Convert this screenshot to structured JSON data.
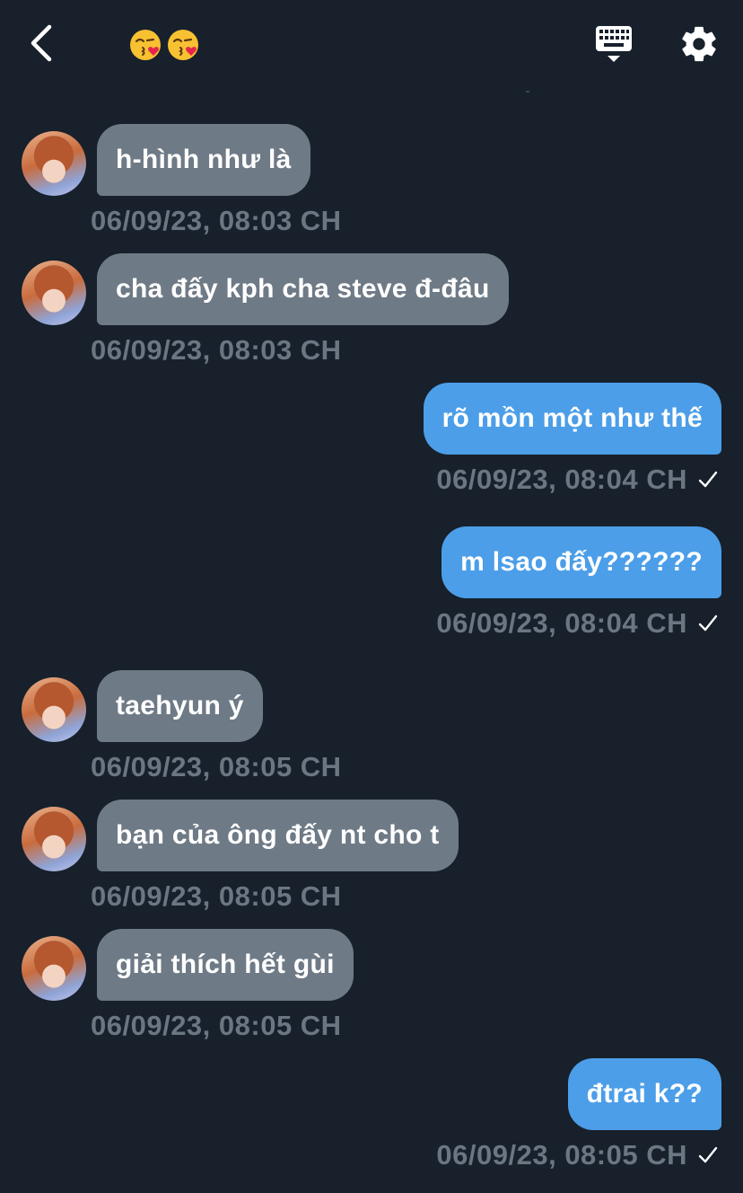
{
  "header": {
    "back_icon": "chevron-left-icon",
    "title_emojis": [
      "face-blowing-kiss-emoji",
      "face-blowing-kiss-emoji"
    ],
    "keyboard_icon": "keyboard-icon",
    "settings_icon": "gear-icon"
  },
  "colors": {
    "background": "#17202b",
    "incoming_bubble": "#6e7a86",
    "outgoing_bubble": "#4c9ee8",
    "timestamp": "#6b7683"
  },
  "messages": [
    {
      "direction": "in",
      "text": "h-hình như là",
      "time": "06/09/23, 08:03 CH"
    },
    {
      "direction": "in",
      "text": "cha đấy kph cha steve đ-đâu",
      "time": "06/09/23, 08:03 CH"
    },
    {
      "direction": "out",
      "text": "rõ mồn một như thế",
      "time": "06/09/23, 08:04 CH",
      "read": true
    },
    {
      "direction": "out",
      "text": "m lsao đấy??????",
      "time": "06/09/23, 08:04 CH",
      "read": true
    },
    {
      "direction": "in",
      "text": "taehyun ý",
      "time": "06/09/23, 08:05 CH"
    },
    {
      "direction": "in",
      "text": "bạn của ông đấy nt cho t",
      "time": "06/09/23, 08:05 CH"
    },
    {
      "direction": "in",
      "text": "giải thích hết gùi",
      "time": "06/09/23, 08:05 CH"
    },
    {
      "direction": "out",
      "text": "đtrai k??",
      "time": "06/09/23, 08:05 CH",
      "read": true
    }
  ]
}
